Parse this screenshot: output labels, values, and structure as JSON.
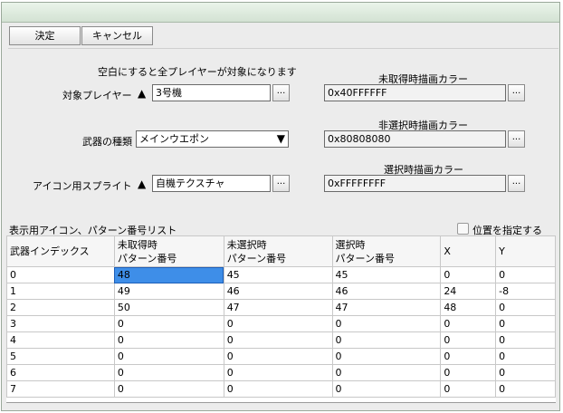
{
  "toolbar": {
    "ok_label": "決定",
    "cancel_label": "キャンセル"
  },
  "target": {
    "note": "空白にすると全プレイヤーが対象になります",
    "label": "対象プレイヤー",
    "arrow": "▲",
    "value": "3号機",
    "more": "..."
  },
  "weapon": {
    "label": "武器の種類",
    "value": "メインウエポン",
    "dropdown_arrow": "▼"
  },
  "sprite": {
    "label": "アイコン用スプライト",
    "arrow": "▲",
    "value": "自機テクスチャ",
    "more": "..."
  },
  "colors": {
    "unacquired_label": "未取得時描画カラー",
    "unacquired_value": "0x40FFFFFF",
    "unselected_label": "非選択時描画カラー",
    "unselected_value": "0x80808080",
    "selected_label": "選択時描画カラー",
    "selected_value": "0xFFFFFFFF",
    "more": "..."
  },
  "list": {
    "title": "表示用アイコン、パターン番号リスト",
    "position_checkbox_label": "位置を指定する",
    "position_checked": false,
    "columns": [
      {
        "line1": "武器インデックス",
        "line2": ""
      },
      {
        "line1": "未取得時",
        "line2": "パターン番号"
      },
      {
        "line1": "未選択時",
        "line2": "パターン番号"
      },
      {
        "line1": "選択時",
        "line2": "パターン番号"
      },
      {
        "line1": "X",
        "line2": ""
      },
      {
        "line1": "Y",
        "line2": ""
      }
    ],
    "rows": [
      [
        "0",
        "48",
        "45",
        "45",
        "0",
        "0"
      ],
      [
        "1",
        "49",
        "46",
        "46",
        "24",
        "-8"
      ],
      [
        "2",
        "50",
        "47",
        "47",
        "48",
        "0"
      ],
      [
        "3",
        "0",
        "0",
        "0",
        "0",
        "0"
      ],
      [
        "4",
        "0",
        "0",
        "0",
        "0",
        "0"
      ],
      [
        "5",
        "0",
        "0",
        "0",
        "0",
        "0"
      ],
      [
        "6",
        "0",
        "0",
        "0",
        "0",
        "0"
      ],
      [
        "7",
        "0",
        "0",
        "0",
        "0",
        "0"
      ]
    ],
    "selected_cell": [
      0,
      1
    ]
  }
}
